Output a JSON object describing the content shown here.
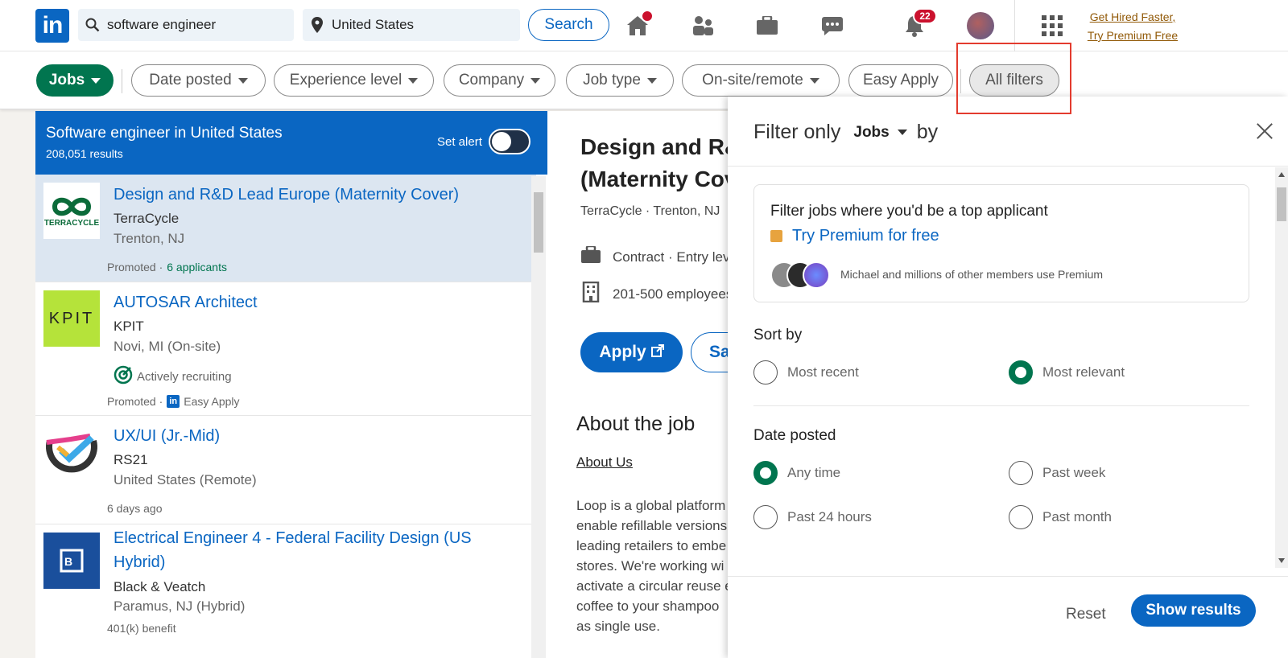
{
  "topnav": {
    "logo": "in",
    "keyword": "software engineer",
    "location": "United States",
    "search_label": "Search",
    "notifications_count": "22",
    "premium_line1": "Get Hired Faster,",
    "premium_line2": "Try Premium Free"
  },
  "filterbar": {
    "jobs": "Jobs",
    "date_posted": "Date posted",
    "experience": "Experience level",
    "company": "Company",
    "job_type": "Job type",
    "onsite": "On-site/remote",
    "easy_apply": "Easy Apply",
    "all_filters": "All filters"
  },
  "list": {
    "title": "Software engineer in United States",
    "count": "208,051 results",
    "set_alert": "Set alert",
    "jobs": [
      {
        "title": "Design and R&D Lead Europe (Maternity Cover)",
        "company": "TerraCycle",
        "location": "Trenton, NJ",
        "meta_prefix": "Promoted · ",
        "meta_highlight": "6 applicants",
        "logo_text": "TERRACYCLE"
      },
      {
        "title": "AUTOSAR Architect",
        "company": "KPIT",
        "location": "Novi, MI (On-site)",
        "status": "Actively recruiting",
        "meta_prefix": "Promoted · ",
        "meta_extra": "Easy Apply",
        "logo_text": "KPIT"
      },
      {
        "title": "UX/UI (Jr.-Mid)",
        "company": "RS21",
        "location": "United States (Remote)",
        "meta_prefix": "6 days ago"
      },
      {
        "title": "Electrical Engineer 4 - Federal Facility Design (US Hybrid)",
        "company": "Black & Veatch",
        "location": "Paramus, NJ (Hybrid)",
        "meta_prefix": "401(k) benefit"
      }
    ]
  },
  "detail": {
    "title": "Design and R&D Lead Europe (Maternity Cover)",
    "company_line": "TerraCycle ·  Trenton, NJ",
    "type_line": "Contract · Entry level",
    "size_line": "201-500 employees",
    "apply_label": "Apply",
    "save_label": "Save",
    "about_heading": "About the job",
    "about_sub": "About Us",
    "about_body": "Loop is a global platform\nenable refillable versions\nleading retailers to embe\nstores. We're working wi\nactivate a circular reuse e\ncoffee to your shampoo\nas single use."
  },
  "modal": {
    "filter_only": "Filter only",
    "jobs_dropdown": "Jobs",
    "by": "by",
    "premium_heading": "Filter jobs where you'd be a top applicant",
    "premium_try": "Try Premium for free",
    "premium_members": "Michael and millions of other members use Premium",
    "sort_heading": "Sort by",
    "sort_recent": "Most recent",
    "sort_relevant": "Most relevant",
    "date_heading": "Date posted",
    "date_any": "Any time",
    "date_week": "Past week",
    "date_24": "Past 24 hours",
    "date_month": "Past month",
    "reset_label": "Reset",
    "show_results_label": "Show results"
  },
  "colors": {
    "brand": "#0a66c2",
    "selected_green": "#01754f",
    "highlight_red": "#e33b2e"
  }
}
